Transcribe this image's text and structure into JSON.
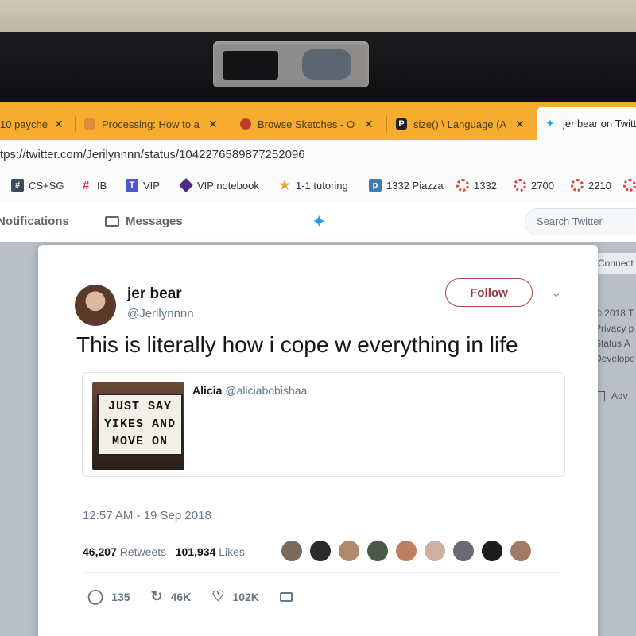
{
  "browser": {
    "tabs": [
      {
        "label": "10 payche",
        "color": "#c0392b"
      },
      {
        "label": "Processing: How to a",
        "color": "#e08a3c"
      },
      {
        "label": "Browse Sketches - O",
        "color": "#c0392b"
      },
      {
        "label": "size() \\ Language (A",
        "color": "#222222"
      },
      {
        "label": "jer bear on Twitt",
        "color": "#1da1f2"
      }
    ],
    "tab_close_glyph": "✕",
    "url": "tps://twitter.com/Jerilynnnn/status/1042276589877252096",
    "bookmarks": [
      {
        "label": "CS+SG",
        "icon": "hash-icon",
        "color": "#3e4a5a"
      },
      {
        "label": "IB",
        "icon": "slack-icon",
        "color": "#e01e5a"
      },
      {
        "label": "VIP",
        "icon": "teams-icon",
        "color": "#5059c9"
      },
      {
        "label": "VIP notebook",
        "icon": "cube-icon",
        "color": "#4b2e83"
      },
      {
        "label": "1-1 tutoring",
        "icon": "star-icon",
        "color": "#e6a83c"
      },
      {
        "label": "1332 Piazza",
        "icon": "piazza-icon",
        "color": "#3e7cb1"
      },
      {
        "label": "1332",
        "icon": "canvas-icon",
        "color": "#e0453a"
      },
      {
        "label": "2700",
        "icon": "canvas-icon",
        "color": "#e0453a"
      },
      {
        "label": "2210",
        "icon": "canvas-icon",
        "color": "#e0453a"
      }
    ]
  },
  "twitter_nav": {
    "notifications": "Notifications",
    "messages": "Messages",
    "search_placeholder": "Search Twitter",
    "accent": "#1da1f2"
  },
  "right_column": {
    "connect": "Connect",
    "footer": [
      "© 2018 T",
      "Privacy p",
      "Status  A",
      "Develope"
    ],
    "adv": "Adv"
  },
  "tweet": {
    "name": "jer bear",
    "handle": "@Jerilynnnn",
    "follow_label": "Follow",
    "text": "This is literally how i cope w everything in life",
    "quote": {
      "name": "Alicia",
      "handle": "@aliciabobishaa",
      "image_lines": [
        "JUST SAY",
        "YIKES AND",
        "MOVE ON"
      ]
    },
    "timestamp": "12:57 AM - 19 Sep 2018",
    "retweets_count": "46,207",
    "retweets_label": "Retweets",
    "likes_count": "101,934",
    "likes_label": "Likes",
    "actions": {
      "replies": "135",
      "retweets": "46K",
      "likes": "102K"
    }
  }
}
